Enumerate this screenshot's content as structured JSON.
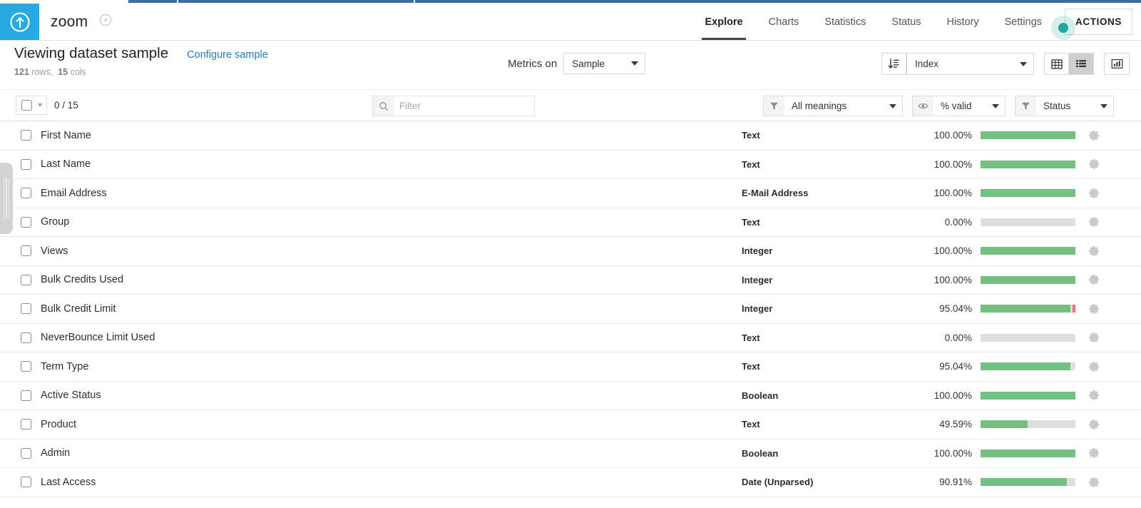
{
  "brand": {
    "name": "zoom",
    "logo_icon": "circle-up-arrow-logo",
    "badge_icon": "compass-badge-icon"
  },
  "nav": {
    "items": [
      {
        "label": "Explore",
        "active": true
      },
      {
        "label": "Charts",
        "active": false
      },
      {
        "label": "Statistics",
        "active": false
      },
      {
        "label": "Status",
        "active": false
      },
      {
        "label": "History",
        "active": false
      },
      {
        "label": "Settings",
        "active": false
      }
    ],
    "actions_label": "ACTIONS"
  },
  "subheader": {
    "title": "Viewing dataset sample",
    "configure_link": "Configure sample",
    "rows_count": "121",
    "rows_word": "rows,",
    "cols_count": "15",
    "cols_word": "cols",
    "metrics_label": "Metrics on",
    "metrics_value": "Sample",
    "sort_value": "Index",
    "sort_icon": "sort-ascending-icon",
    "grid_view_icon": "grid-view-icon",
    "list_view_icon": "list-view-icon",
    "chart_view_icon": "chart-view-icon"
  },
  "filterbar": {
    "select_count": "0 / 15",
    "filter_placeholder": "Filter",
    "filter_value": "",
    "search_icon": "search-icon",
    "meanings_value": "All meanings",
    "meanings_icon": "funnel-icon",
    "valid_value": "% valid",
    "valid_icon": "eye-icon",
    "status_value": "Status",
    "status_icon": "funnel-icon"
  },
  "colors": {
    "brand_blue": "#29a9e1",
    "link_blue": "#1c7cc0",
    "bar_ok": "#73c082",
    "bar_bad": "#ef6e78",
    "bar_empty": "#dedede",
    "cursor_teal": "#23a8a0",
    "tab_blue": "#3d6ca3"
  },
  "columns": [
    {
      "name": "First Name",
      "type": "Text",
      "percent": "100.00%",
      "valid": 100.0,
      "invalid": 0
    },
    {
      "name": "Last Name",
      "type": "Text",
      "percent": "100.00%",
      "valid": 100.0,
      "invalid": 0
    },
    {
      "name": "Email Address",
      "type": "E-Mail Address",
      "percent": "100.00%",
      "valid": 100.0,
      "invalid": 0
    },
    {
      "name": "Group",
      "type": "Text",
      "percent": "0.00%",
      "valid": 0.0,
      "invalid": 0
    },
    {
      "name": "Views",
      "type": "Integer",
      "percent": "100.00%",
      "valid": 100.0,
      "invalid": 0
    },
    {
      "name": "Bulk Credits Used",
      "type": "Integer",
      "percent": "100.00%",
      "valid": 100.0,
      "invalid": 0
    },
    {
      "name": "Bulk Credit Limit",
      "type": "Integer",
      "percent": "95.04%",
      "valid": 95.04,
      "invalid": 3.3
    },
    {
      "name": "NeverBounce Limit Used",
      "type": "Text",
      "percent": "0.00%",
      "valid": 0.0,
      "invalid": 0
    },
    {
      "name": "Term Type",
      "type": "Text",
      "percent": "95.04%",
      "valid": 95.04,
      "invalid": 0
    },
    {
      "name": "Active Status",
      "type": "Boolean",
      "percent": "100.00%",
      "valid": 100.0,
      "invalid": 0
    },
    {
      "name": "Product",
      "type": "Text",
      "percent": "49.59%",
      "valid": 49.59,
      "invalid": 0
    },
    {
      "name": "Admin",
      "type": "Boolean",
      "percent": "100.00%",
      "valid": 100.0,
      "invalid": 0
    },
    {
      "name": "Last Access",
      "type": "Date (Unparsed)",
      "percent": "90.91%",
      "valid": 90.91,
      "invalid": 0
    }
  ],
  "row_icons": {
    "checkbox": "row-checkbox",
    "gear": "gear-icon"
  }
}
